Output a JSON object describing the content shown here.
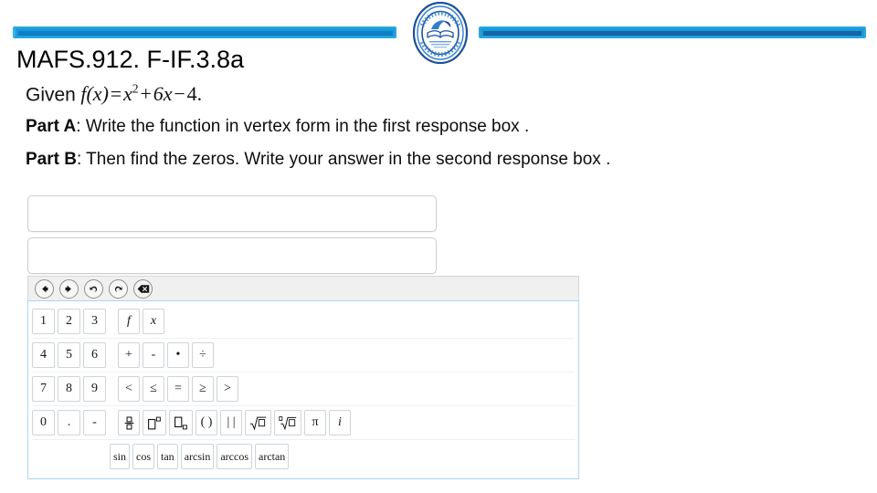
{
  "header": {
    "logo_name": "school-seal-logo",
    "accent_color_light": "#1a9ad8",
    "accent_color_dark": "#0f7fc4",
    "accent_color_navy": "#1565a8"
  },
  "title": "MAFS.912. F-IF.3.8a",
  "prompt": {
    "given_lead": "Given",
    "function_name": "f",
    "function_arg": "(x)",
    "equals": "=",
    "term1_base": "x",
    "term1_exp": "2",
    "plus": "+",
    "term2": "6x",
    "minus": "−",
    "term3": "4",
    "period": ".",
    "part_a_label": "Part A",
    "part_a_text": ": Write the function in vertex form in the first response box .",
    "part_b_label": "Part B",
    "part_b_text": ": Then find the zeros. Write your answer in the second response box ."
  },
  "response_boxes": [
    {
      "name": "response-box-1",
      "value": "",
      "placeholder": ""
    },
    {
      "name": "response-box-2",
      "value": "",
      "placeholder": ""
    }
  ],
  "keypad": {
    "toolbar": [
      {
        "name": "move-left-icon",
        "label": "←"
      },
      {
        "name": "move-right-icon",
        "label": "→"
      },
      {
        "name": "undo-icon",
        "label": "↶"
      },
      {
        "name": "redo-icon",
        "label": "↷"
      },
      {
        "name": "backspace-icon",
        "label": "⌫"
      }
    ],
    "rows": [
      {
        "digits": [
          "1",
          "2",
          "3"
        ],
        "ops": [
          {
            "name": "key-function-f",
            "label": "f",
            "style": "italic"
          },
          {
            "name": "key-variable-x",
            "label": "x",
            "style": "italic"
          }
        ]
      },
      {
        "digits": [
          "4",
          "5",
          "6"
        ],
        "ops": [
          {
            "name": "key-plus",
            "label": "+"
          },
          {
            "name": "key-minus",
            "label": "-"
          },
          {
            "name": "key-multiply-dot",
            "label": "•"
          },
          {
            "name": "key-divide",
            "label": "÷"
          }
        ]
      },
      {
        "digits": [
          "7",
          "8",
          "9"
        ],
        "ops": [
          {
            "name": "key-less-than",
            "label": "<"
          },
          {
            "name": "key-less-equal",
            "label": "≤"
          },
          {
            "name": "key-equals",
            "label": "="
          },
          {
            "name": "key-greater-equal",
            "label": "≥"
          },
          {
            "name": "key-greater-than",
            "label": ">"
          }
        ]
      },
      {
        "digits": [
          "0",
          ".",
          "-"
        ],
        "ops": [
          {
            "name": "key-fraction",
            "label": "",
            "glyph": "fraction"
          },
          {
            "name": "key-superscript",
            "label": "",
            "glyph": "superscript"
          },
          {
            "name": "key-subscript",
            "label": "",
            "glyph": "subscript"
          },
          {
            "name": "key-parentheses",
            "label": "( )"
          },
          {
            "name": "key-absolute-value",
            "label": "| |"
          },
          {
            "name": "key-square-root",
            "label": "",
            "glyph": "sqrt"
          },
          {
            "name": "key-nth-root",
            "label": "",
            "glyph": "nthroot"
          },
          {
            "name": "key-pi",
            "label": "π"
          },
          {
            "name": "key-imaginary-i",
            "label": "i",
            "style": "italic"
          }
        ]
      },
      {
        "digits": [],
        "ops": [
          {
            "name": "key-sin",
            "label": "sin"
          },
          {
            "name": "key-cos",
            "label": "cos"
          },
          {
            "name": "key-tan",
            "label": "tan"
          },
          {
            "name": "key-arcsin",
            "label": "arcsin"
          },
          {
            "name": "key-arccos",
            "label": "arccos"
          },
          {
            "name": "key-arctan",
            "label": "arctan"
          }
        ]
      }
    ]
  }
}
